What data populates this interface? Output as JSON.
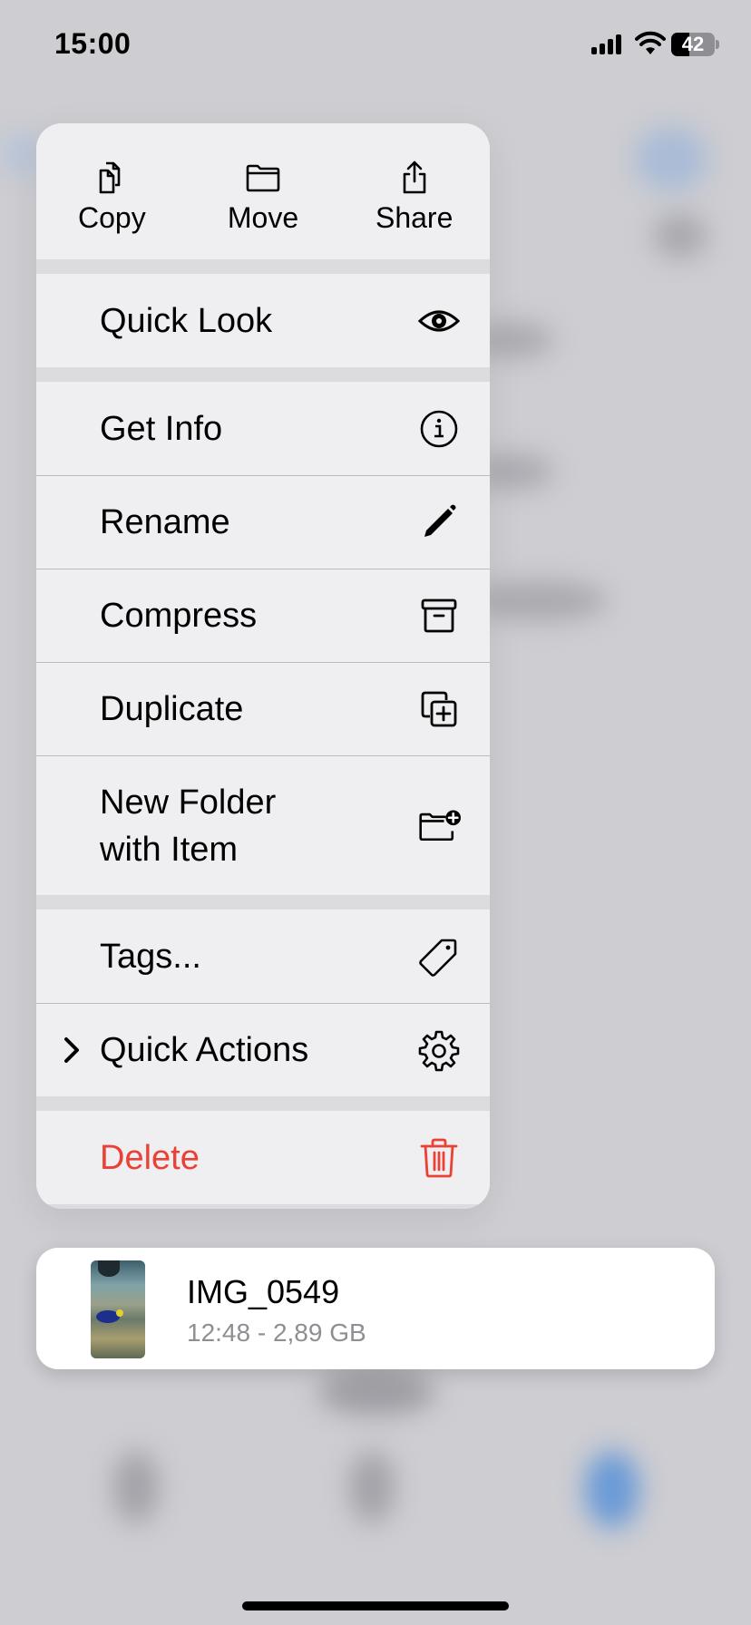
{
  "status_bar": {
    "time": "15:00",
    "battery_percent": "42",
    "battery_level": 0.42,
    "signal_bars": 4,
    "icons": [
      "cellular-signal-icon",
      "wifi-icon",
      "battery-icon"
    ]
  },
  "context_menu": {
    "top_actions": [
      {
        "label": "Copy",
        "icon": "copy-icon"
      },
      {
        "label": "Move",
        "icon": "folder-icon"
      },
      {
        "label": "Share",
        "icon": "share-icon"
      }
    ],
    "items": [
      {
        "label": "Quick Look",
        "icon": "eye-icon"
      },
      {
        "label": "Get Info",
        "icon": "info-icon"
      },
      {
        "label": "Rename",
        "icon": "pencil-icon"
      },
      {
        "label": "Compress",
        "icon": "archive-box-icon"
      },
      {
        "label": "Duplicate",
        "icon": "duplicate-icon"
      },
      {
        "label": "New Folder\nwith Item",
        "label_line1": "New Folder",
        "label_line2": "with Item",
        "icon": "folder-plus-icon"
      },
      {
        "label": "Tags...",
        "icon": "tag-icon"
      },
      {
        "label": "Quick Actions",
        "icon": "gear-icon",
        "has_submenu": true
      },
      {
        "label": "Delete",
        "icon": "trash-icon",
        "destructive": true
      }
    ],
    "colors": {
      "destructive": "#eb4034",
      "background": "#efeff1",
      "separator_band": "#dcdcdf"
    }
  },
  "file_preview": {
    "name": "IMG_0549",
    "meta": "12:48 - 2,89 GB"
  }
}
